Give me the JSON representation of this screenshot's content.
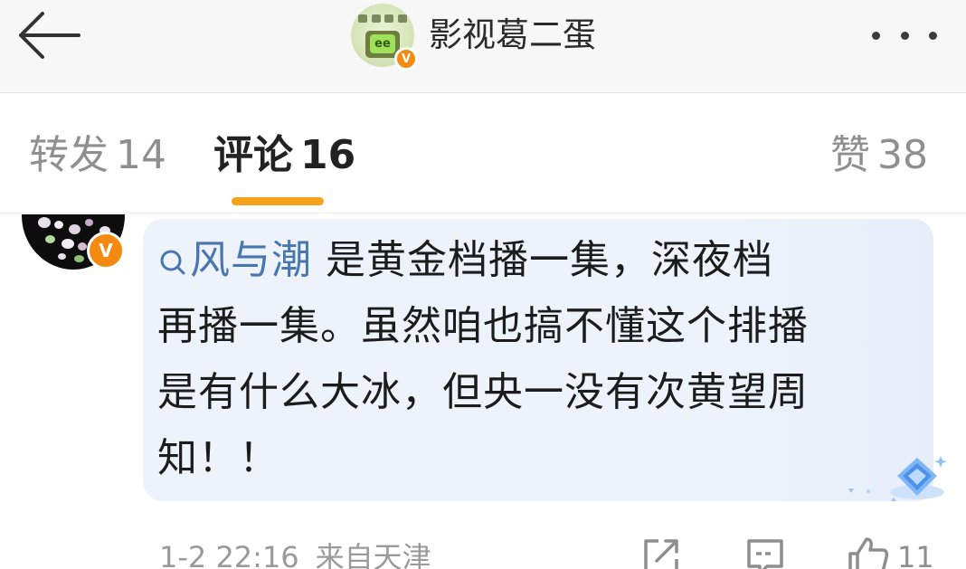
{
  "header": {
    "back_icon": "arrow-left-icon",
    "account_name": "影视葛二蛋",
    "avatar_badge": "V",
    "avatar_tv_label": "ee",
    "more_icon": "more-dots-icon"
  },
  "tabs": [
    {
      "label": "转发",
      "count": "14",
      "active": false
    },
    {
      "label": "评论",
      "count": "16",
      "active": true
    },
    {
      "label": "赞",
      "count": "38",
      "active": false
    }
  ],
  "colors": {
    "accent": "#f5a21b",
    "mention": "#4876b0",
    "bubble_bg": "#eef3fb",
    "verified_badge": "#f58a11"
  },
  "comment": {
    "avatar_badge": "V",
    "mention": "风与潮",
    "lines": [
      " 是黄金档播一集，深夜档",
      "再播一集。虽然咱也搞不懂这个排播",
      "是有什么大冰，但央一没有次黄望周",
      "知！！"
    ],
    "timestamp": "1-2 22:16",
    "location": "来自天津",
    "like_count": "11"
  }
}
